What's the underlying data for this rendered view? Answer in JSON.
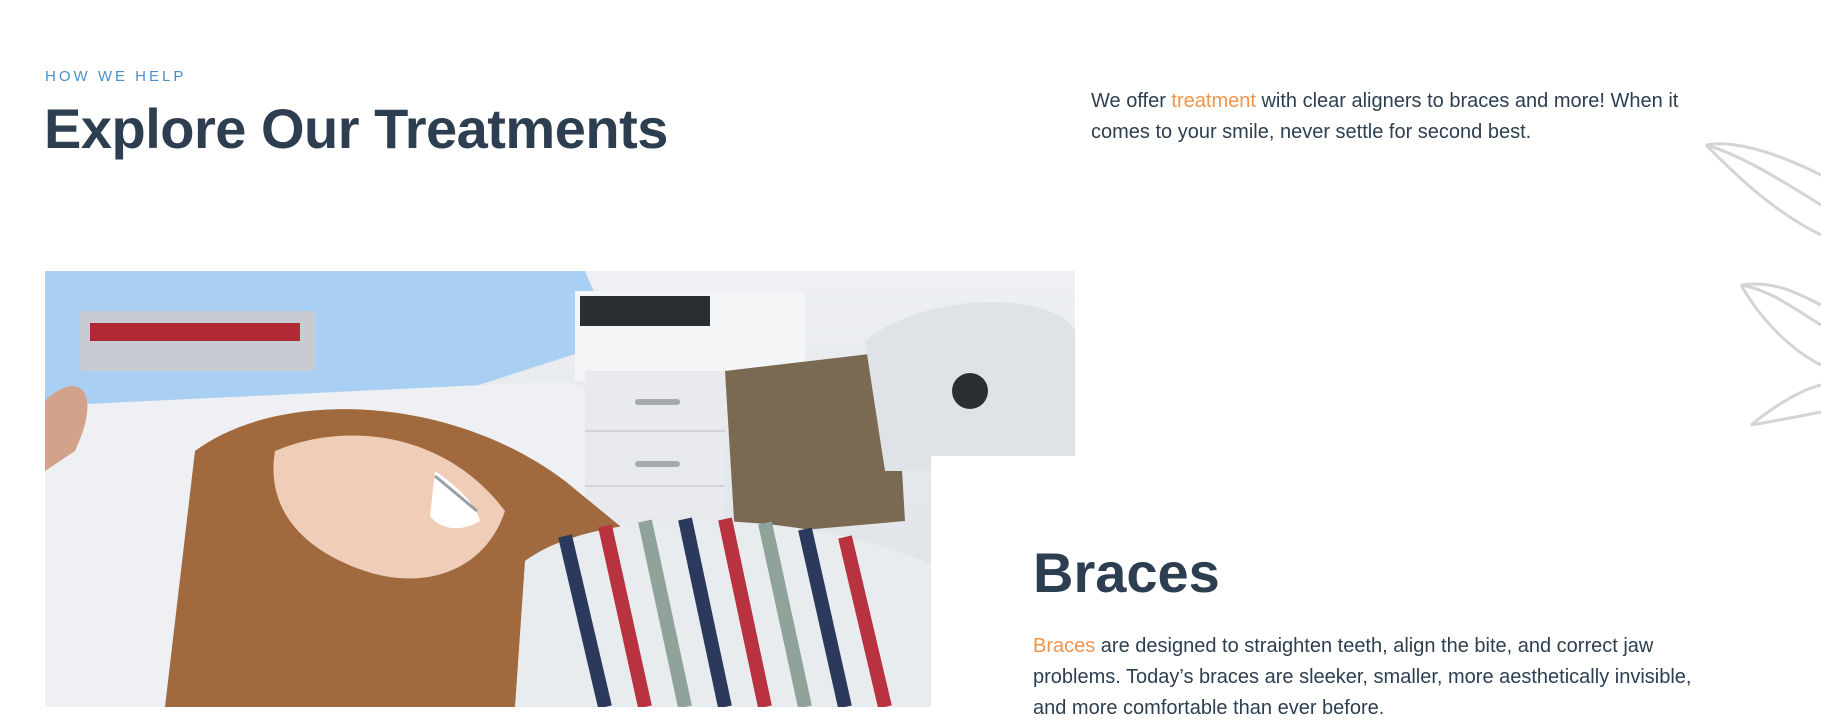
{
  "header": {
    "eyebrow": "HOW WE HELP",
    "title": "Explore Our Treatments"
  },
  "intro": {
    "prefix": "We offer ",
    "link": "treatment",
    "suffix": " with clear aligners to braces and more! When it comes to your smile, never settle for second best."
  },
  "treatment": {
    "title": "Braces",
    "link": "Braces",
    "text": " are designed to straighten teeth, align the bite, and correct jaw problems. Today’s braces are sleeker, smaller, more aesthetically invisible, and more comfortable than ever before."
  },
  "colors": {
    "heading": "#2c3e50",
    "eyebrow": "#4a90c8",
    "accent": "#f0944d"
  },
  "icons": {
    "decoration": "leaf-outline-icon"
  }
}
